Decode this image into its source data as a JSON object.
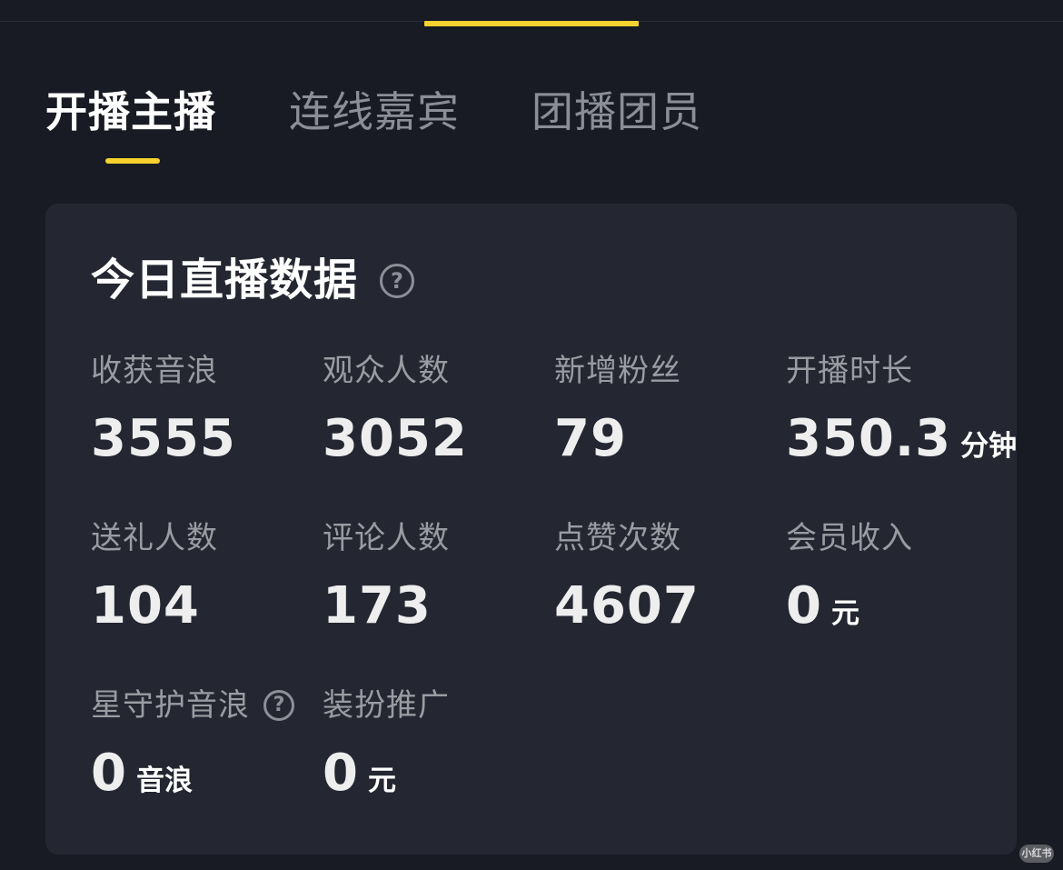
{
  "tabs": [
    {
      "label": "开播主播",
      "active": true
    },
    {
      "label": "连线嘉宾",
      "active": false
    },
    {
      "label": "团播团员",
      "active": false
    }
  ],
  "card": {
    "title": "今日直播数据",
    "help_icon": "question-circle-icon",
    "metrics": [
      {
        "label": "收获音浪",
        "value": "3555",
        "unit": ""
      },
      {
        "label": "观众人数",
        "value": "3052",
        "unit": ""
      },
      {
        "label": "新增粉丝",
        "value": "79",
        "unit": ""
      },
      {
        "label": "开播时长",
        "value": "350.3",
        "unit": "分钟"
      },
      {
        "label": "送礼人数",
        "value": "104",
        "unit": ""
      },
      {
        "label": "评论人数",
        "value": "173",
        "unit": ""
      },
      {
        "label": "点赞次数",
        "value": "4607",
        "unit": ""
      },
      {
        "label": "会员收入",
        "value": "0",
        "unit": "元"
      },
      {
        "label": "星守护音浪",
        "value": "0",
        "unit": "音浪"
      },
      {
        "label": "装扮推广",
        "value": "0",
        "unit": "元"
      }
    ]
  },
  "watermark": "小红书",
  "colors": {
    "background": "#181b23",
    "card": "#242731",
    "accent": "#f5d22e",
    "muted_text": "#9a9ca3"
  }
}
